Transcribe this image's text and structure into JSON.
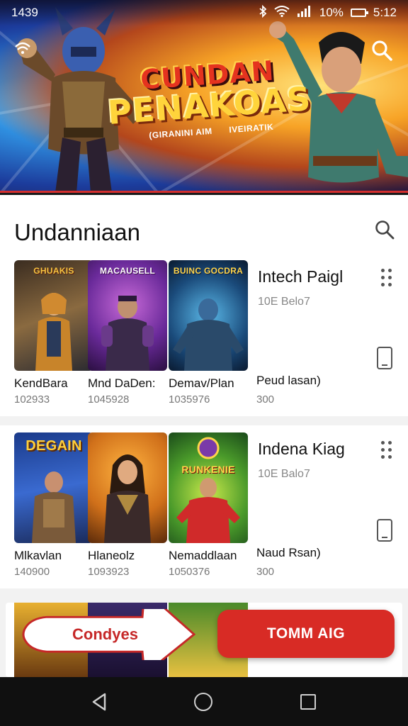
{
  "status_bar": {
    "time_left": "1439",
    "battery": "10%",
    "time_right": "5:12"
  },
  "hero": {
    "title_line1": "CUNDAN",
    "title_line2": "PENAKOAS",
    "subtitle_left": "(GIRANINI AIM",
    "subtitle_right": "IVEIRATIK"
  },
  "section": {
    "title": "Undanniaan"
  },
  "row1": {
    "side_title": "Intech Paigl",
    "side_sub": "10E Belo7",
    "side_name": "Peud lasan)",
    "side_num": "300",
    "cards": [
      {
        "banner": "GHUAKIS",
        "name": "KendBara",
        "num": "102933"
      },
      {
        "banner": "MACAUSELL",
        "name": "Mnd DaDen:",
        "num": "1045928"
      },
      {
        "banner": "BUINC GOCDRA",
        "name": "Demav/Plan",
        "num": "1035976"
      }
    ]
  },
  "row2": {
    "side_title": "Indena Kiag",
    "side_sub": "10E Balo7",
    "side_name": "Naud Rsan)",
    "side_num": "300",
    "cards": [
      {
        "banner": "DEGAIN",
        "name": "Mlkavlan",
        "num": "140900"
      },
      {
        "banner": "",
        "name": "Hlaneolz",
        "num": "1093923"
      },
      {
        "banner": "RUNKENIE",
        "name": "Nemaddlaan",
        "num": "1050376"
      }
    ]
  },
  "buttons": {
    "left_label": "Condyes",
    "right_label": "TOMM AIG"
  },
  "colors": {
    "accent_red": "#d82b25",
    "text_dark": "#111111",
    "text_muted": "#777777"
  }
}
